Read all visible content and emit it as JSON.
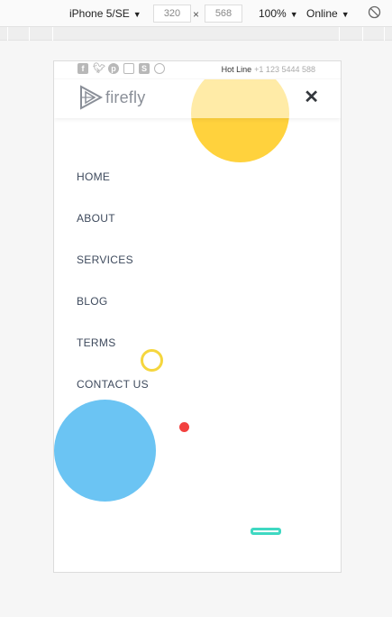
{
  "devtools": {
    "device": "iPhone 5/SE",
    "width": "320",
    "times": "×",
    "height": "568",
    "zoom": "100%",
    "network": "Online",
    "rotate_icon": "rotate-icon"
  },
  "site": {
    "social_icons": [
      "facebook-icon",
      "twitter-icon",
      "pinterest-icon",
      "instagram-icon",
      "skype-icon",
      "dribbble-icon"
    ],
    "hotline_label": "Hot Line",
    "hotline_number": "+1 123 5444 588",
    "logo_text": "firefly",
    "close_icon": "close-icon",
    "menu": [
      "HOME",
      "ABOUT",
      "SERVICES",
      "BLOG",
      "TERMS",
      "CONTACT US"
    ],
    "colors": {
      "yellow": "#ffd23d",
      "blue": "#6bc4f3",
      "red": "#f2413f",
      "teal": "#3fd8c2",
      "menu_text": "#3e4a5d"
    }
  }
}
